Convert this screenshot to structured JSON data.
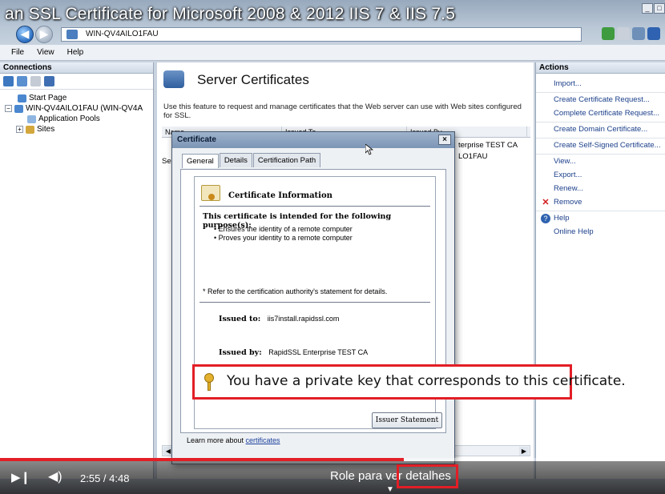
{
  "video": {
    "title": "an SSL Certificate for Microsoft 2008 & 2012 IIS 7 & IIS 7.5",
    "time": "2:55 / 4:48",
    "subtitle": "Role para ver detalhes",
    "progress": 0.607,
    "accent_color": "#e21e26"
  },
  "window": {
    "address": "WIN-QV4AILO1FAU",
    "menu": [
      "File",
      "View",
      "Help"
    ],
    "controls": [
      "_",
      "□"
    ]
  },
  "connections": {
    "header": "Connections",
    "tree": [
      {
        "label": "Start Page",
        "icon": "start-page-icon"
      },
      {
        "label": "WIN-QV4AILO1FAU (WIN-QV4A",
        "icon": "server-icon",
        "toggle": "−"
      },
      {
        "label": "Application Pools",
        "icon": "app-pools-icon"
      },
      {
        "label": "Sites",
        "icon": "sites-icon",
        "toggle": "+"
      }
    ]
  },
  "center": {
    "title": "Server Certificates",
    "description": "Use this feature to request and manage certificates that the Web server can use with Web sites configured for SSL.",
    "columns": [
      "Name",
      "Issued To",
      "Issued By"
    ],
    "row_issued_by": "terprise TEST CA",
    "row_issued_to": "LO1FAU",
    "row_name_fragment": "Se"
  },
  "actions": {
    "header": "Actions",
    "items": [
      {
        "label": "Import...",
        "icon": ""
      },
      {
        "label": "Create Certificate Request...",
        "icon": "",
        "sep": true
      },
      {
        "label": "Complete Certificate Request...",
        "icon": ""
      },
      {
        "label": "Create Domain Certificate...",
        "icon": "",
        "sep": true
      },
      {
        "label": "Create Self-Signed Certificate...",
        "icon": "",
        "sep": true
      },
      {
        "label": "View...",
        "icon": "",
        "sep": true
      },
      {
        "label": "Export...",
        "icon": ""
      },
      {
        "label": "Renew...",
        "icon": ""
      },
      {
        "label": "Remove",
        "icon": "remove-icon"
      },
      {
        "label": "Help",
        "icon": "help-icon",
        "sep": true
      },
      {
        "label": "Online Help",
        "icon": ""
      }
    ]
  },
  "dialog": {
    "title": "Certificate",
    "close": "×",
    "tabs": [
      "General",
      "Details",
      "Certification Path"
    ],
    "info_title": "Certificate Information",
    "purpose_heading": "This certificate is intended for the following purpose(s):",
    "purposes": [
      "• Ensures the identity of a remote computer",
      "• Proves your identity to a remote computer"
    ],
    "refer": "* Refer to the certification authority's statement for details.",
    "issued_to_label": "Issued to:",
    "issued_to": "iis7install.rapidssl.com",
    "issued_by_label": "Issued by:",
    "issued_by": "RapidSSL Enterprise TEST CA",
    "private_key_note": "You have a private key that corresponds to this certificate.",
    "issuer_button": "Issuer Statement",
    "learn_more_prefix": "Learn more about ",
    "learn_more_link": "certificates"
  }
}
